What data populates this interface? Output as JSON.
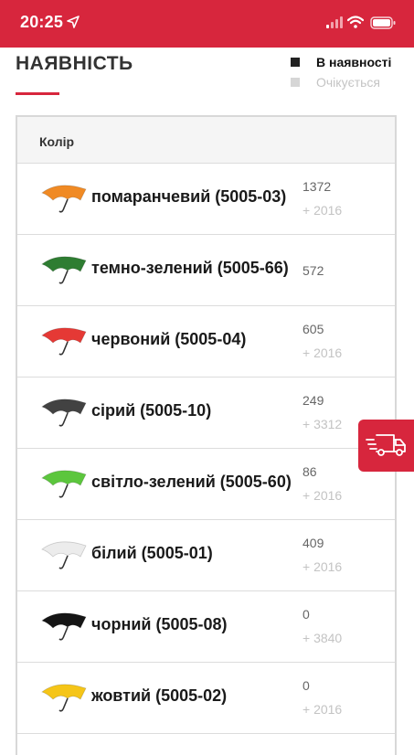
{
  "status_bar": {
    "time": "20:25",
    "background_color": "#d7263d",
    "icons": [
      "location-arrow-icon",
      "signal-icon",
      "wifi-icon",
      "battery-icon"
    ]
  },
  "availability": {
    "title": "НАЯВНІСТЬ",
    "accent_color": "#d7263d",
    "legend": {
      "in_stock": "В наявності",
      "expected": "Очікується"
    },
    "table": {
      "column_header": "Колір",
      "rows": [
        {
          "label": "помаранчевий (5005-03)",
          "stock": "1372",
          "expected": "+ 2016",
          "color": "#f08a24"
        },
        {
          "label": "темно-зелений (5005-66)",
          "stock": "572",
          "expected": "",
          "color": "#2e7d32"
        },
        {
          "label": "червоний (5005-04)",
          "stock": "605",
          "expected": "+ 2016",
          "color": "#e53935"
        },
        {
          "label": "сірий (5005-10)",
          "stock": "249",
          "expected": "+ 3312",
          "color": "#424242"
        },
        {
          "label": "світло-зелений (5005-60)",
          "stock": "86",
          "expected": "+ 2016",
          "color": "#5cc63d"
        },
        {
          "label": "білий (5005-01)",
          "stock": "409",
          "expected": "+ 2016",
          "color": "#ececec"
        },
        {
          "label": "чорний (5005-08)",
          "stock": "0",
          "expected": "+ 3840",
          "color": "#151515"
        },
        {
          "label": "жовтий (5005-02)",
          "stock": "0",
          "expected": "+ 2016",
          "color": "#f5c518"
        }
      ]
    }
  },
  "delivery_button": {
    "icon": "delivery-truck-icon"
  }
}
